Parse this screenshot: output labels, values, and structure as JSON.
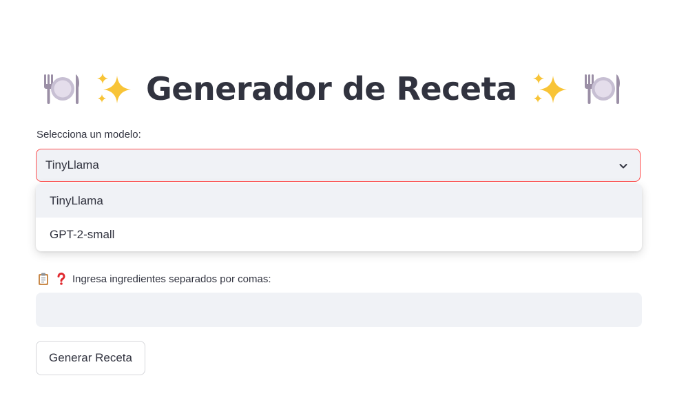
{
  "header": {
    "title": "Generador de Receta",
    "icons": [
      "fork-knife-plate-icon",
      "sparkles-icon",
      "sparkles-icon",
      "fork-knife-plate-icon"
    ]
  },
  "model_select": {
    "label": "Selecciona un modelo:",
    "selected": "TinyLlama",
    "state": "open",
    "options": [
      "TinyLlama",
      "GPT-2-small"
    ]
  },
  "ingredients": {
    "label": "Ingresa ingredientes separados por comas:",
    "label_icons": [
      "clipboard-icon",
      "question-mark-icon"
    ],
    "value": "",
    "placeholder": ""
  },
  "actions": {
    "generate_label": "Generar Receta"
  },
  "colors": {
    "accent_border": "#ff4b4b",
    "input_bg": "#f0f2f6",
    "text": "#31333f",
    "sparkle": "#f8c437"
  }
}
